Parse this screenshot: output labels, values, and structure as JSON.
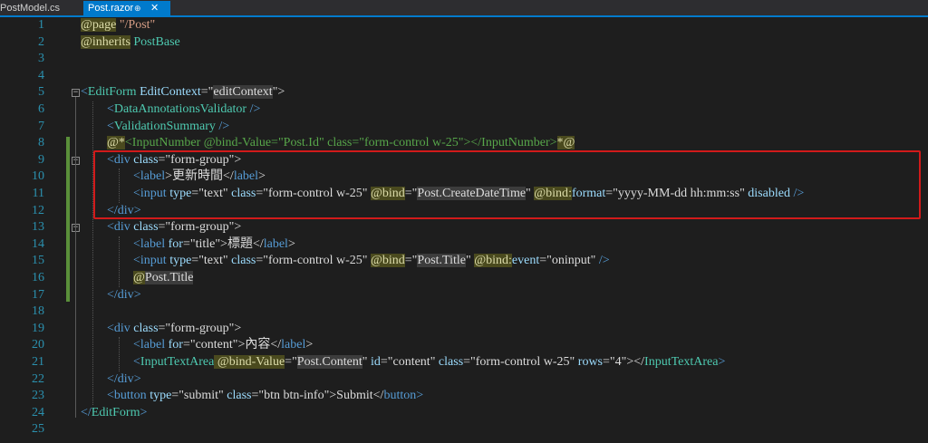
{
  "tabs": [
    {
      "label": "PostModel.cs"
    },
    {
      "label": "Post.razor",
      "pin": "⊕",
      "close": "✕"
    }
  ],
  "lines": [
    {
      "n": "1",
      "segs": [
        {
          "t": "@page",
          "c": "at"
        },
        {
          "t": " \"/Post\"",
          "c": "str"
        }
      ]
    },
    {
      "n": "2",
      "segs": [
        {
          "t": "@inherits",
          "c": "at"
        },
        {
          "t": " ",
          "c": ""
        },
        {
          "t": "PostBase",
          "c": "comp"
        }
      ]
    },
    {
      "n": "3",
      "segs": []
    },
    {
      "n": "4",
      "segs": []
    },
    {
      "n": "5",
      "segs": [
        {
          "t": "<",
          "c": "tag"
        },
        {
          "t": "EditForm",
          "c": "comp"
        },
        {
          "t": " EditContext",
          "c": "attr"
        },
        {
          "t": "=\"",
          "c": ""
        },
        {
          "t": "editContext",
          "c": "sel"
        },
        {
          "t": "\">",
          "c": ""
        }
      ]
    },
    {
      "n": "6",
      "segs": [
        {
          "t": "<",
          "c": "tag"
        },
        {
          "t": "DataAnnotationsValidator",
          "c": "comp"
        },
        {
          "t": " />",
          "c": "tag"
        }
      ]
    },
    {
      "n": "7",
      "segs": [
        {
          "t": "<",
          "c": "tag"
        },
        {
          "t": "ValidationSummary",
          "c": "comp"
        },
        {
          "t": " />",
          "c": "tag"
        }
      ]
    },
    {
      "n": "8",
      "segs": [
        {
          "t": "@*",
          "c": "at"
        },
        {
          "t": "<InputNumber @bind-Value=\"Post.Id\" class=\"form-control w-25\"></InputNumber>",
          "c": "cmt"
        },
        {
          "t": "*@",
          "c": "at"
        }
      ]
    },
    {
      "n": "9",
      "segs": [
        {
          "t": "<",
          "c": "tag"
        },
        {
          "t": "div",
          "c": "tag"
        },
        {
          "t": " class",
          "c": "attr"
        },
        {
          "t": "=\"form-group\">",
          "c": ""
        }
      ]
    },
    {
      "n": "10",
      "segs": [
        {
          "t": "<",
          "c": "tag"
        },
        {
          "t": "label",
          "c": "tag"
        },
        {
          "t": ">更新時間</",
          "c": ""
        },
        {
          "t": "label",
          "c": "tag"
        },
        {
          "t": ">",
          "c": ""
        }
      ]
    },
    {
      "n": "11",
      "segs": [
        {
          "t": "<",
          "c": "tag"
        },
        {
          "t": "input",
          "c": "tag"
        },
        {
          "t": " type",
          "c": "attr"
        },
        {
          "t": "=\"text\"",
          "c": ""
        },
        {
          "t": " class",
          "c": "attr"
        },
        {
          "t": "=\"form-control w-25\" ",
          "c": ""
        },
        {
          "t": "@bind",
          "c": "at"
        },
        {
          "t": "=\"",
          "c": ""
        },
        {
          "t": "Post.CreateDateTime",
          "c": "hl"
        },
        {
          "t": "\" ",
          "c": ""
        },
        {
          "t": "@bind",
          "c": "at"
        },
        {
          "t": ":",
          "c": "at"
        },
        {
          "t": "format",
          "c": "attr"
        },
        {
          "t": "=\"yyyy-MM-dd hh:mm:ss\"",
          "c": ""
        },
        {
          "t": " disabled",
          "c": "attr"
        },
        {
          "t": " />",
          "c": "tag"
        }
      ]
    },
    {
      "n": "12",
      "segs": [
        {
          "t": "</",
          "c": "tag"
        },
        {
          "t": "div",
          "c": "tag"
        },
        {
          "t": ">",
          "c": "tag"
        }
      ]
    },
    {
      "n": "13",
      "segs": [
        {
          "t": "<",
          "c": "tag"
        },
        {
          "t": "div",
          "c": "tag"
        },
        {
          "t": " class",
          "c": "attr"
        },
        {
          "t": "=\"form-group\">",
          "c": ""
        }
      ]
    },
    {
      "n": "14",
      "segs": [
        {
          "t": "<",
          "c": "tag"
        },
        {
          "t": "label",
          "c": "tag"
        },
        {
          "t": " for",
          "c": "attr"
        },
        {
          "t": "=\"title\">標題</",
          "c": ""
        },
        {
          "t": "label",
          "c": "tag"
        },
        {
          "t": ">",
          "c": ""
        }
      ]
    },
    {
      "n": "15",
      "segs": [
        {
          "t": "<",
          "c": "tag"
        },
        {
          "t": "input",
          "c": "tag"
        },
        {
          "t": " type",
          "c": "attr"
        },
        {
          "t": "=\"text\"",
          "c": ""
        },
        {
          "t": " class",
          "c": "attr"
        },
        {
          "t": "=\"form-control w-25\" ",
          "c": ""
        },
        {
          "t": "@bind",
          "c": "at"
        },
        {
          "t": "=\"",
          "c": ""
        },
        {
          "t": "Post.Title",
          "c": "hl"
        },
        {
          "t": "\" ",
          "c": ""
        },
        {
          "t": "@bind",
          "c": "at"
        },
        {
          "t": ":",
          "c": "at"
        },
        {
          "t": "event",
          "c": "attr"
        },
        {
          "t": "=\"oninput\"",
          "c": ""
        },
        {
          "t": " />",
          "c": "tag"
        }
      ]
    },
    {
      "n": "16",
      "segs": [
        {
          "t": "@",
          "c": "at"
        },
        {
          "t": "Post.Title",
          "c": "hl"
        }
      ]
    },
    {
      "n": "17",
      "segs": [
        {
          "t": "</",
          "c": "tag"
        },
        {
          "t": "div",
          "c": "tag"
        },
        {
          "t": ">",
          "c": "tag"
        }
      ]
    },
    {
      "n": "18",
      "segs": []
    },
    {
      "n": "19",
      "segs": [
        {
          "t": "<",
          "c": "tag"
        },
        {
          "t": "div",
          "c": "tag"
        },
        {
          "t": " class",
          "c": "attr"
        },
        {
          "t": "=\"form-group\">",
          "c": ""
        }
      ]
    },
    {
      "n": "20",
      "segs": [
        {
          "t": "<",
          "c": "tag"
        },
        {
          "t": "label",
          "c": "tag"
        },
        {
          "t": " for",
          "c": "attr"
        },
        {
          "t": "=\"content\">內容</",
          "c": ""
        },
        {
          "t": "label",
          "c": "tag"
        },
        {
          "t": ">",
          "c": ""
        }
      ]
    },
    {
      "n": "21",
      "segs": [
        {
          "t": "<",
          "c": "tag"
        },
        {
          "t": "InputTextArea",
          "c": "comp"
        },
        {
          "t": " @bind-Value",
          "c": "at"
        },
        {
          "t": "=\"",
          "c": ""
        },
        {
          "t": "Post.Content",
          "c": "hl"
        },
        {
          "t": "\"",
          "c": ""
        },
        {
          "t": " id",
          "c": "attr"
        },
        {
          "t": "=\"content\"",
          "c": ""
        },
        {
          "t": " class",
          "c": "attr"
        },
        {
          "t": "=\"form-control w-25\"",
          "c": ""
        },
        {
          "t": " rows",
          "c": "attr"
        },
        {
          "t": "=\"4\"></",
          "c": ""
        },
        {
          "t": "InputTextArea",
          "c": "comp"
        },
        {
          "t": ">",
          "c": "tag"
        }
      ]
    },
    {
      "n": "22",
      "segs": [
        {
          "t": "</",
          "c": "tag"
        },
        {
          "t": "div",
          "c": "tag"
        },
        {
          "t": ">",
          "c": "tag"
        }
      ]
    },
    {
      "n": "23",
      "segs": [
        {
          "t": "<",
          "c": "tag"
        },
        {
          "t": "button",
          "c": "tag"
        },
        {
          "t": " type",
          "c": "attr"
        },
        {
          "t": "=\"submit\"",
          "c": ""
        },
        {
          "t": " class",
          "c": "attr"
        },
        {
          "t": "=\"btn btn-info\">Submit</",
          "c": ""
        },
        {
          "t": "button",
          "c": "tag"
        },
        {
          "t": ">",
          "c": "tag"
        }
      ]
    },
    {
      "n": "24",
      "segs": [
        {
          "t": "</",
          "c": "tag"
        },
        {
          "t": "EditForm",
          "c": "comp"
        },
        {
          "t": ">",
          "c": "tag"
        }
      ]
    },
    {
      "n": "25",
      "segs": []
    }
  ],
  "colors": {
    "accent": "#007acc",
    "highlight_box": "#d11a1a",
    "line_number": "#2b91af"
  }
}
